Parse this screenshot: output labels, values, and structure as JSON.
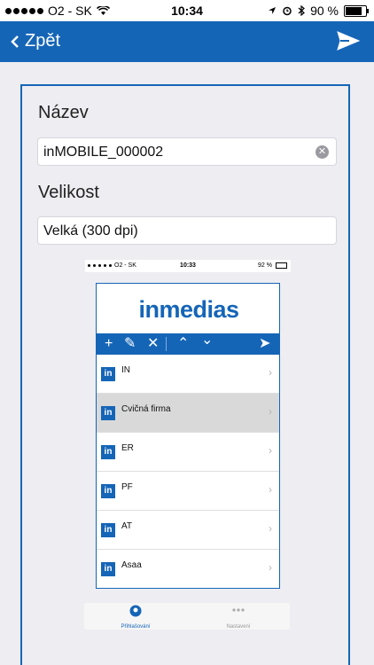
{
  "status_bar": {
    "carrier": "O2 - SK",
    "time": "10:34",
    "battery": "90 %",
    "battery_level": 0.9
  },
  "nav": {
    "back_label": "Zpět"
  },
  "form": {
    "name_label": "Název",
    "name_value": "inMOBILE_000002",
    "size_label": "Velikost",
    "size_value": "Velká (300 dpi)"
  },
  "preview": {
    "status_bar": {
      "carrier": "O2 - SK",
      "time": "10:33",
      "battery": "92 %"
    },
    "logo_text": "inmedias",
    "items": [
      {
        "label": "IN"
      },
      {
        "label": "Cvičná firma"
      },
      {
        "label": "ER"
      },
      {
        "label": "PF"
      },
      {
        "label": "AT"
      },
      {
        "label": "Asaa"
      }
    ],
    "tabs": [
      {
        "label": "Přihlašování"
      },
      {
        "label": "Nastavení"
      }
    ]
  },
  "colors": {
    "accent": "#1565b7",
    "selected_row": "#d9d9d9"
  }
}
